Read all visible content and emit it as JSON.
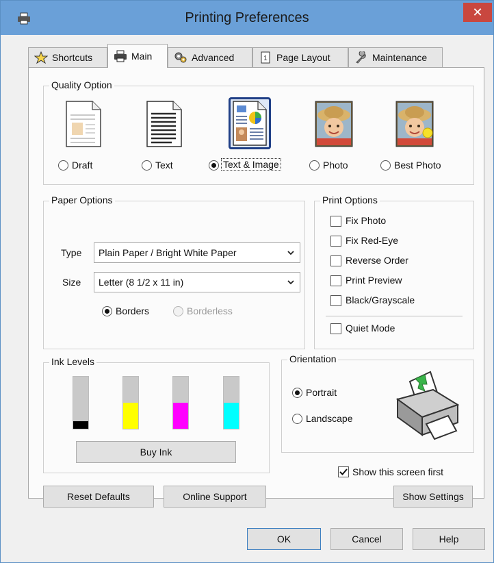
{
  "window": {
    "title": "Printing Preferences",
    "close_label": "✕"
  },
  "tabs": [
    {
      "label": "Shortcuts",
      "icon": "star-icon"
    },
    {
      "label": "Main",
      "icon": "printer-icon"
    },
    {
      "label": "Advanced",
      "icon": "gears-icon"
    },
    {
      "label": "Page Layout",
      "icon": "page-layout-icon"
    },
    {
      "label": "Maintenance",
      "icon": "wrench-icon"
    }
  ],
  "quality": {
    "title": "Quality Option",
    "selected": "Text & Image",
    "options": [
      {
        "label": "Draft",
        "icon": "draft-document-icon"
      },
      {
        "label": "Text",
        "icon": "text-document-icon"
      },
      {
        "label": "Text & Image",
        "icon": "text-image-document-icon"
      },
      {
        "label": "Photo",
        "icon": "photo-icon"
      },
      {
        "label": "Best Photo",
        "icon": "best-photo-icon"
      }
    ]
  },
  "paper": {
    "title": "Paper Options",
    "type_label": "Type",
    "type_value": "Plain Paper / Bright White Paper",
    "size_label": "Size",
    "size_value": "Letter (8 1/2 x 11 in)",
    "borders_label": "Borders",
    "borderless_label": "Borderless",
    "selected": "Borders"
  },
  "print_options": {
    "title": "Print Options",
    "items": [
      {
        "label": "Fix Photo",
        "checked": false
      },
      {
        "label": "Fix Red-Eye",
        "checked": false
      },
      {
        "label": "Reverse Order",
        "checked": false
      },
      {
        "label": "Print Preview",
        "checked": false
      },
      {
        "label": "Black/Grayscale",
        "checked": false
      }
    ],
    "quiet_mode": {
      "label": "Quiet Mode",
      "checked": false
    }
  },
  "ink": {
    "title": "Ink Levels",
    "tanks": [
      {
        "color": "#000000",
        "level": 0.15
      },
      {
        "color": "#ffff00",
        "level": 0.5
      },
      {
        "color": "#ff00ff",
        "level": 0.5
      },
      {
        "color": "#00ffff",
        "level": 0.5
      }
    ],
    "buy_label": "Buy Ink"
  },
  "orientation": {
    "title": "Orientation",
    "portrait_label": "Portrait",
    "landscape_label": "Landscape",
    "selected": "Portrait"
  },
  "show_screen_first": {
    "label": "Show this screen first",
    "checked": true
  },
  "buttons": {
    "reset": "Reset Defaults",
    "online_support": "Online Support",
    "show_settings": "Show Settings",
    "ok": "OK",
    "cancel": "Cancel",
    "help": "Help"
  },
  "colors": {
    "titlebar": "#6aa0d8",
    "close": "#c9473f",
    "selection": "#1f3f86"
  }
}
